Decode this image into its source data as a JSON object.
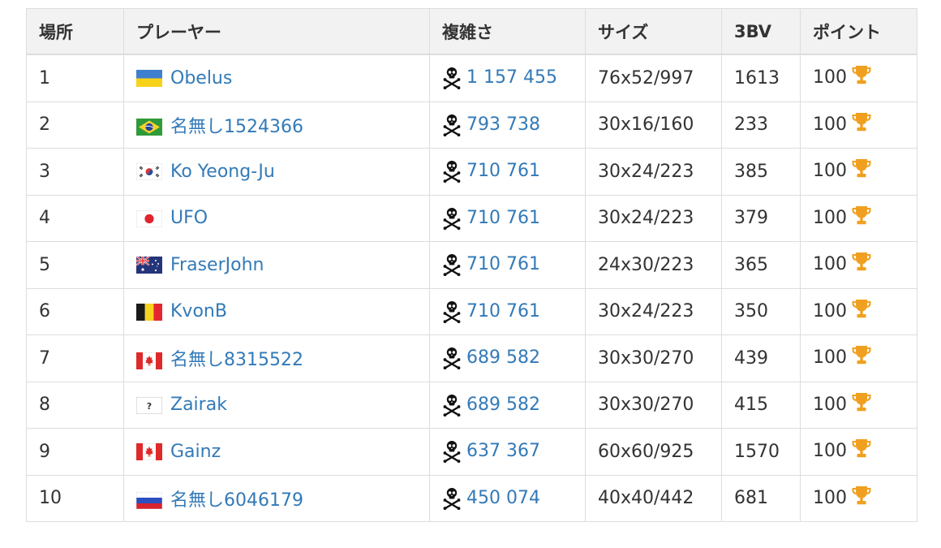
{
  "table": {
    "headers": {
      "rank": "場所",
      "player": "プレーヤー",
      "complexity": "複雑さ",
      "size": "サイズ",
      "bv": "3BV",
      "points": "ポイント"
    },
    "rows": [
      {
        "rank": "1",
        "flag": "ukraine-flag",
        "player": "Obelus",
        "complexity": "1 157 455",
        "size": "76x52/997",
        "bv": "1613",
        "points": "100"
      },
      {
        "rank": "2",
        "flag": "brazil-flag",
        "player": "名無し1524366",
        "complexity": "793 738",
        "size": "30x16/160",
        "bv": "233",
        "points": "100"
      },
      {
        "rank": "3",
        "flag": "south-korea-flag",
        "player": "Ko Yeong-Ju",
        "complexity": "710 761",
        "size": "30x24/223",
        "bv": "385",
        "points": "100"
      },
      {
        "rank": "4",
        "flag": "japan-flag",
        "player": "UFO",
        "complexity": "710 761",
        "size": "30x24/223",
        "bv": "379",
        "points": "100"
      },
      {
        "rank": "5",
        "flag": "australia-flag",
        "player": "FraserJohn",
        "complexity": "710 761",
        "size": "24x30/223",
        "bv": "365",
        "points": "100"
      },
      {
        "rank": "6",
        "flag": "belgium-flag",
        "player": "KvonB",
        "complexity": "710 761",
        "size": "30x24/223",
        "bv": "350",
        "points": "100"
      },
      {
        "rank": "7",
        "flag": "canada-flag",
        "player": "名無し8315522",
        "complexity": "689 582",
        "size": "30x30/270",
        "bv": "439",
        "points": "100"
      },
      {
        "rank": "8",
        "flag": "unknown-flag",
        "player": "Zairak",
        "complexity": "689 582",
        "size": "30x30/270",
        "bv": "415",
        "points": "100"
      },
      {
        "rank": "9",
        "flag": "canada-flag",
        "player": "Gainz",
        "complexity": "637 367",
        "size": "60x60/925",
        "bv": "1570",
        "points": "100"
      },
      {
        "rank": "10",
        "flag": "russia-flag",
        "player": "名無し6046179",
        "complexity": "450 074",
        "size": "40x40/442",
        "bv": "681",
        "points": "100"
      }
    ]
  },
  "icons": {
    "complexity": "skull-crossbones-icon",
    "points": "trophy-icon"
  },
  "colors": {
    "link": "#337ab7",
    "trophy": "#f0a020",
    "header_bg": "#f2f2f2",
    "border": "#dddddd"
  }
}
